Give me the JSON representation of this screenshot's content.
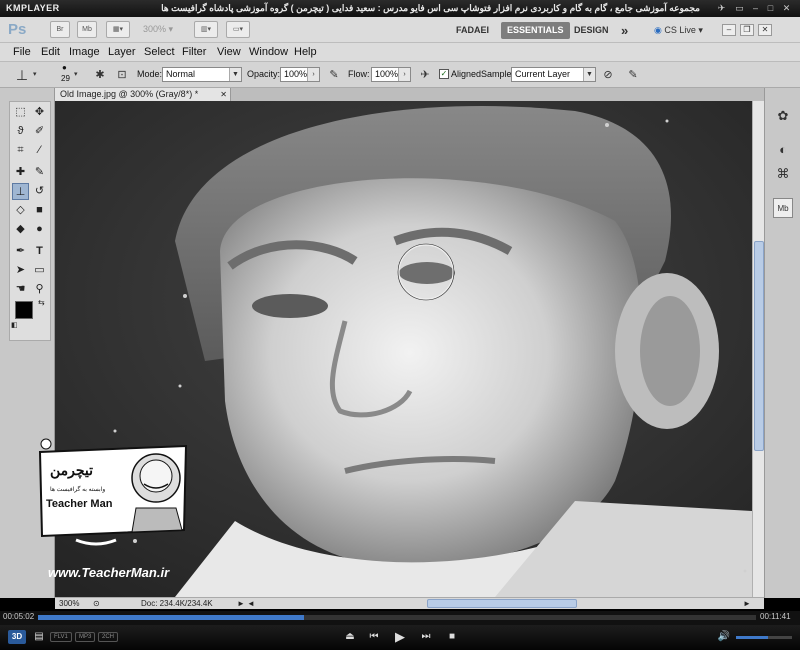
{
  "player": {
    "logo": "KMPLAYER",
    "caption": "مجموعه آموزشی جامع ، گام به گام و کاربردی نرم افزار فتوشاپ سی اس فایو  مدرس : سعید فدایی ( تیچرمن ) گروه آموزشی پادشاه گرافیست ها",
    "time_elapsed": "00:05:02",
    "time_total": "00:11:41",
    "progress": 0.37,
    "volume": 0.58,
    "mode_3d": "3D",
    "badges": [
      "FLV1",
      "MP3",
      "2CH"
    ]
  },
  "ps": {
    "logo": "Ps",
    "app_buttons": [
      "Br",
      "Mb"
    ],
    "zoom_level": "300%",
    "workspaces": [
      "FADAEI",
      "ESSENTIALS",
      "DESIGN"
    ],
    "more_label": "»",
    "cs_live": "CS Live",
    "menu": [
      "File",
      "Edit",
      "Image",
      "Layer",
      "Select",
      "Filter",
      "View",
      "Window",
      "Help"
    ],
    "options": {
      "brush_size": "29",
      "mode_label": "Mode:",
      "mode_value": "Normal",
      "opacity_label": "Opacity:",
      "opacity_value": "100%",
      "flow_label": "Flow:",
      "flow_value": "100%",
      "aligned_label": "Aligned",
      "aligned_checked": true,
      "sample_label": "Sample:",
      "sample_value": "Current Layer"
    },
    "document_tab": "Old Image.jpg @ 300% (Gray/8*) *",
    "status_zoom": "300%",
    "status_doc": "Doc: 234.4K/234.4K"
  },
  "watermark": {
    "brand_fa": "تیچرمن",
    "sub_fa": "وابسته به گرافیست ها",
    "brand_en": "Teacher Man",
    "url": "www.TeacherMan.ir"
  }
}
